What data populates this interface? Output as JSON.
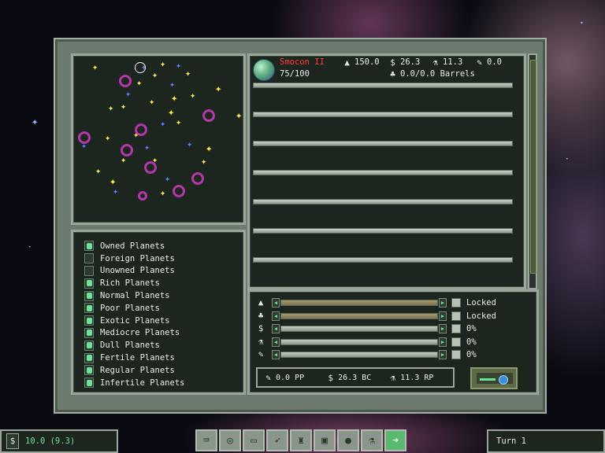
{
  "planet": {
    "name": "Smocon II",
    "population": "75/100",
    "production_stat": "150.0",
    "money_stat": "26.3",
    "research_stat": "11.3",
    "ship_stat": "0.0",
    "barrels": "0.0/0.0 Barrels"
  },
  "filters": [
    {
      "label": "Owned Planets",
      "checked": true
    },
    {
      "label": "Foreign Planets",
      "checked": false
    },
    {
      "label": "Unowned Planets",
      "checked": false
    },
    {
      "label": "Rich Planets",
      "checked": true
    },
    {
      "label": "Normal Planets",
      "checked": true
    },
    {
      "label": "Poor Planets",
      "checked": true
    },
    {
      "label": "Exotic Planets",
      "checked": true
    },
    {
      "label": "Mediocre Planets",
      "checked": true
    },
    {
      "label": "Dull Planets",
      "checked": true
    },
    {
      "label": "Fertile Planets",
      "checked": true
    },
    {
      "label": "Regular Planets",
      "checked": true
    },
    {
      "label": "Infertile Planets",
      "checked": true
    }
  ],
  "sliders": [
    {
      "icon": "production-icon",
      "value": "Locked",
      "locked": true
    },
    {
      "icon": "barrel-icon",
      "value": "Locked",
      "locked": true
    },
    {
      "icon": "dollar-icon",
      "value": "0%",
      "locked": false
    },
    {
      "icon": "research-icon",
      "value": "0%",
      "locked": false
    },
    {
      "icon": "wrench-icon",
      "value": "0%",
      "locked": false
    }
  ],
  "summary": {
    "pp": "0.0 PP",
    "bc": "26.3 BC",
    "rp": "11.3 RP"
  },
  "status": {
    "money": "10.0 (9.3)",
    "turn": "Turn 1"
  },
  "toolbar": [
    "gamepad-icon",
    "galaxy-icon",
    "ships-icon",
    "fleet-icon",
    "colony-icon",
    "computer-icon",
    "planets-icon",
    "research-icon",
    "next-arrow-icon"
  ]
}
